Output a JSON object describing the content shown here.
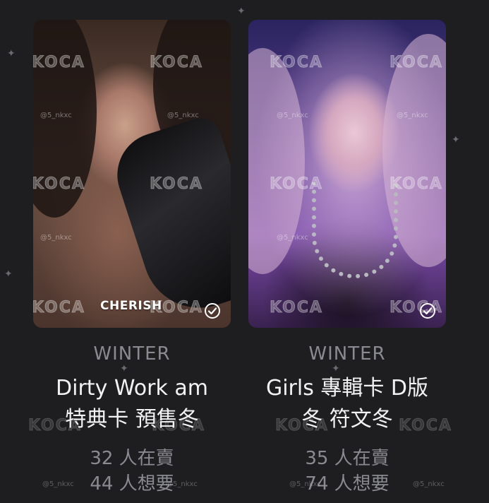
{
  "watermark": {
    "brand": "KOCA",
    "handle": "@5_nkxc"
  },
  "cards": [
    {
      "photo_label": "CHERISH",
      "member": "WINTER",
      "title_line1": "Dirty Work am",
      "title_line2": "特典卡 預售冬",
      "selling": "32 人在賣",
      "wanting": "44 人想要",
      "owned_icon": "check-circle-icon"
    },
    {
      "photo_label": "",
      "member": "WINTER",
      "title_line1": "Girls 專輯卡 D版",
      "title_line2": "冬 符文冬",
      "selling": "35 人在賣",
      "wanting": "74 人想要",
      "owned_icon": "check-circle-icon"
    }
  ]
}
